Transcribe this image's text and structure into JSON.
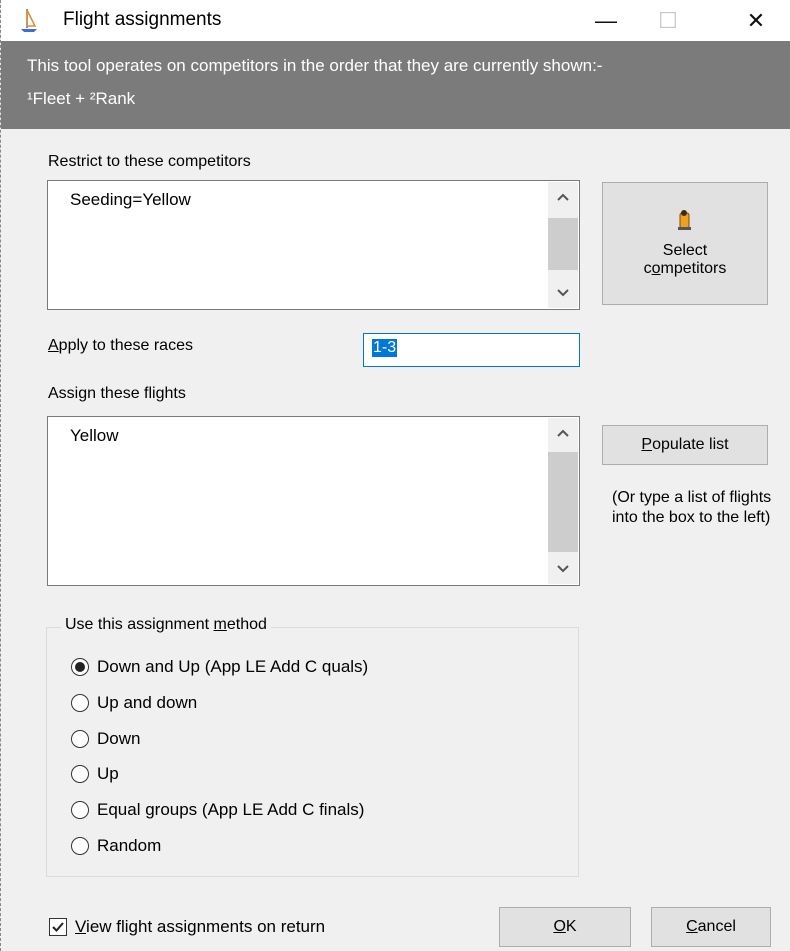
{
  "window": {
    "title": "Flight assignments",
    "minimize_glyph": "—",
    "maximize_glyph": "☐",
    "close_glyph": "✕"
  },
  "banner": {
    "line1": "This tool operates on competitors in the order that they are currently shown:-",
    "line2": "¹Fleet + ²Rank"
  },
  "restrict": {
    "label": "Restrict to these competitors",
    "items": [
      "Seeding=Yellow"
    ]
  },
  "select_button": {
    "line1": "Select",
    "line2_pre": "c",
    "line2_u": "o",
    "line2_post": "mpetitors"
  },
  "races": {
    "label_u": "A",
    "label_rest": "pply to these races",
    "value": "1-3"
  },
  "flights": {
    "label": "Assign these flights",
    "items": [
      "Yellow"
    ]
  },
  "populate_button": {
    "u": "P",
    "rest": "opulate list"
  },
  "hint": "(Or type a list of flights into the box to the left)",
  "method": {
    "title_pre": "Use this assignment ",
    "title_u": "m",
    "title_post": "ethod",
    "options": [
      {
        "label": "Down and Up (App LE Add C quals)",
        "selected": true
      },
      {
        "label": "Up and down",
        "selected": false
      },
      {
        "label": "Down",
        "selected": false
      },
      {
        "label": "Up",
        "selected": false
      },
      {
        "label": "Equal groups (App LE Add C finals)",
        "selected": false
      },
      {
        "label": "Random",
        "selected": false
      }
    ]
  },
  "view_check": {
    "u": "V",
    "rest": "iew flight assignments on return",
    "checked": true
  },
  "ok_button": {
    "u": "O",
    "rest": "K"
  },
  "cancel_button": {
    "u": "C",
    "rest": "ancel"
  },
  "colors": {
    "banner_bg": "#7b7b7b",
    "selection": "#0078d7",
    "dialog_bg": "#f0f0f0"
  }
}
